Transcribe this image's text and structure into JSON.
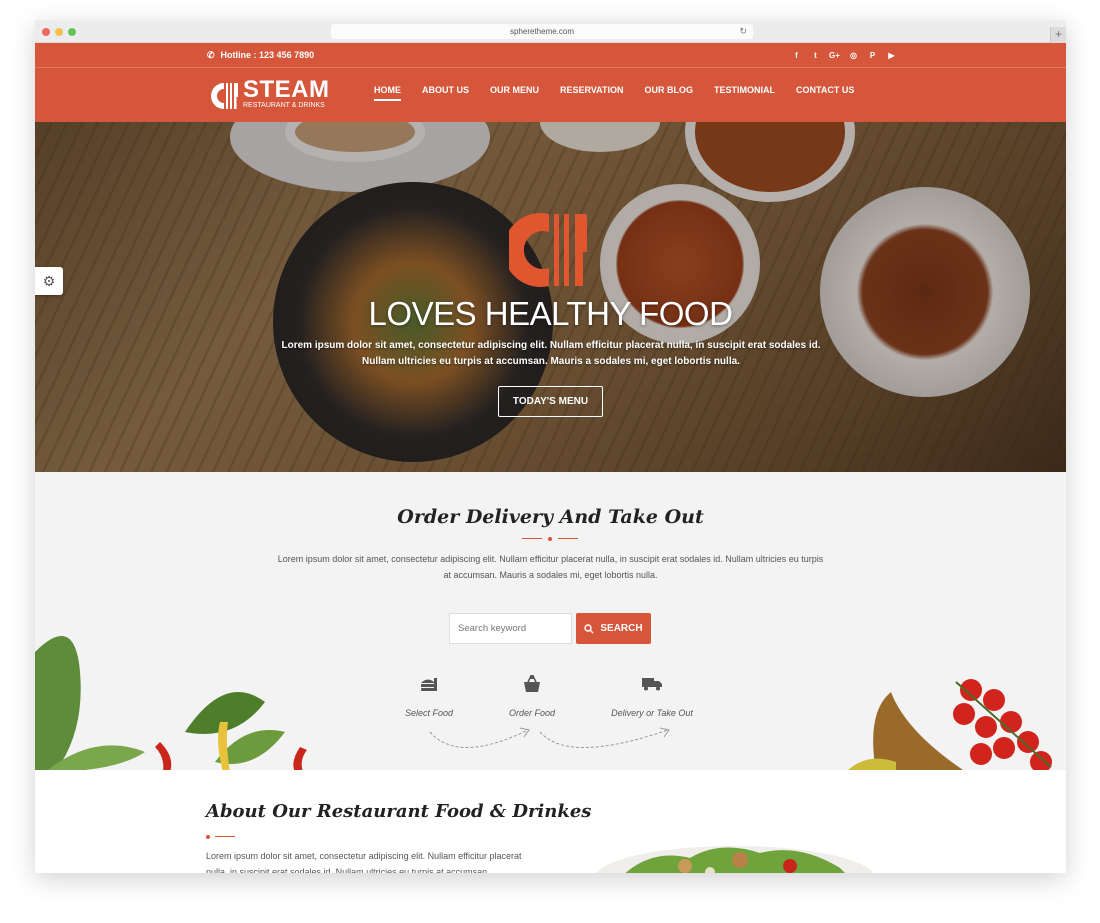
{
  "browser": {
    "url": "spheretheme.com"
  },
  "topbar": {
    "hotline": "Hotline : 123 456 7890",
    "social_icons": [
      "facebook-icon",
      "twitter-icon",
      "google-plus-icon",
      "instagram-icon",
      "pinterest-icon",
      "youtube-icon"
    ],
    "social_glyphs": [
      "f",
      "t",
      "G+",
      "◎",
      "P",
      "▶"
    ]
  },
  "brand": {
    "name": "STEAM",
    "tagline": "RESTAURANT & DRINKS"
  },
  "nav": {
    "items": [
      "HOME",
      "ABOUT US",
      "OUR MENU",
      "RESERVATION",
      "OUR BLOG",
      "TESTIMONIAL",
      "CONTACT US"
    ],
    "active": "HOME"
  },
  "hero": {
    "title": "LOVES HEALTHY FOOD",
    "text": "Lorem ipsum dolor sit amet, consectetur adipiscing elit. Nullam efficitur placerat nulla, in suscipit erat sodales id. Nullam ultricies eu turpis at accumsan. Mauris a sodales mi, eget lobortis nulla.",
    "button": "TODAY'S MENU"
  },
  "order": {
    "title": "Order Delivery And Take Out",
    "text": "Lorem ipsum dolor sit amet, consectetur adipiscing elit. Nullam efficitur placerat nulla, in suscipit erat sodales id. Nullam ultricies eu turpis at accumsan. Mauris a sodales mi, eget lobortis nulla.",
    "search_placeholder": "Search keyword",
    "search_button": "SEARCH",
    "steps": [
      {
        "label": "Select Food",
        "icon": "burger-icon"
      },
      {
        "label": "Order Food",
        "icon": "basket-icon"
      },
      {
        "label": "Delivery or Take Out",
        "icon": "truck-icon"
      }
    ]
  },
  "about": {
    "title": "About Our Restaurant Food & Drinkes",
    "text": "Lorem ipsum dolor sit amet, consectetur adipiscing elit. Nullam efficitur placerat nulla, in suscipit erat sodales id. Nullam ultricies eu turpis at accumsan."
  },
  "colors": {
    "accent": "#d5563a",
    "light_bg": "#f3f3f3"
  }
}
